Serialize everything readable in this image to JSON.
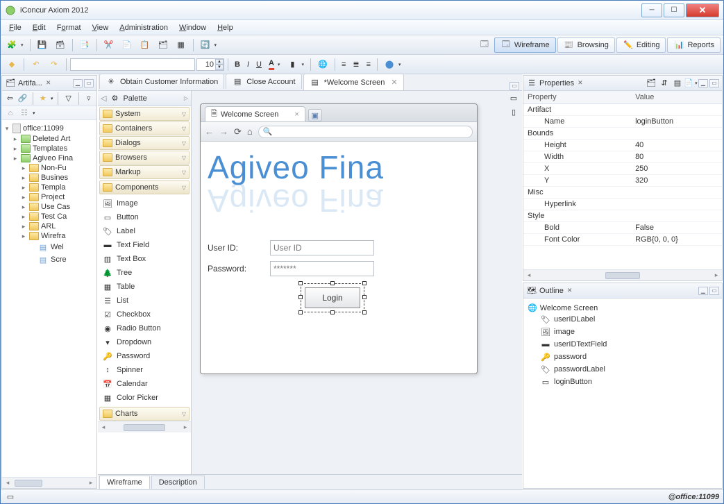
{
  "window": {
    "title": "iConcur Axiom 2012"
  },
  "menus": [
    "File",
    "Edit",
    "Format",
    "View",
    "Administration",
    "Window",
    "Help"
  ],
  "fontsize": "10",
  "modes": {
    "wireframe": "Wireframe",
    "browsing": "Browsing",
    "editing": "Editing",
    "reports": "Reports"
  },
  "leftPane": {
    "title": "Artifa...",
    "root": "office:11099",
    "nodes": [
      {
        "l": "Deleted Art",
        "c": "grn",
        "i": 1
      },
      {
        "l": "Templates",
        "c": "grn",
        "i": 1
      },
      {
        "l": "Agiveo Fina",
        "c": "grn",
        "i": 1
      },
      {
        "l": "Non-Fu",
        "c": "yel",
        "i": 2
      },
      {
        "l": "Busines",
        "c": "yel",
        "i": 2
      },
      {
        "l": "Templa",
        "c": "yel",
        "i": 2
      },
      {
        "l": "Project",
        "c": "yel",
        "i": 2
      },
      {
        "l": "Use Cas",
        "c": "yel",
        "i": 2
      },
      {
        "l": "Test Ca",
        "c": "yel",
        "i": 2
      },
      {
        "l": "ARL",
        "c": "yel",
        "i": 2
      },
      {
        "l": "Wirefra",
        "c": "yel",
        "i": 2
      },
      {
        "l": "Wel",
        "c": "doc",
        "i": 3
      },
      {
        "l": "Scre",
        "c": "doc",
        "i": 3
      }
    ]
  },
  "editorTabs": [
    {
      "label": "Obtain Customer Information",
      "ico": "flow"
    },
    {
      "label": "Close Account",
      "ico": "doc"
    },
    {
      "label": "*Welcome Screen",
      "ico": "doc",
      "active": true
    }
  ],
  "palette": {
    "title": "Palette",
    "cats": [
      "System",
      "Containers",
      "Dialogs",
      "Browsers",
      "Markup"
    ],
    "open": "Components",
    "items": [
      "Image",
      "Button",
      "Label",
      "Text Field",
      "Text Box",
      "Tree",
      "Table",
      "List",
      "Checkbox",
      "Radio Button",
      "Dropdown",
      "Password",
      "Spinner",
      "Calendar",
      "Color Picker"
    ],
    "last": "Charts"
  },
  "mockup": {
    "tab": "Welcome Screen",
    "logo": "Agiveo Fina",
    "userLabel": "User ID:",
    "userPlaceholder": "User ID",
    "passLabel": "Password:",
    "passValue": "*******",
    "login": "Login"
  },
  "bottomTabs": {
    "a": "Wireframe",
    "b": "Description"
  },
  "propsPane": {
    "title": "Properties",
    "cols": {
      "a": "Property",
      "b": "Value"
    },
    "rows": [
      {
        "g": "Artifact"
      },
      {
        "k": "Name",
        "v": "loginButton",
        "i": 1
      },
      {
        "g": "Bounds"
      },
      {
        "k": "Height",
        "v": "40",
        "i": 1
      },
      {
        "k": "Width",
        "v": "80",
        "i": 1
      },
      {
        "k": "X",
        "v": "250",
        "i": 1
      },
      {
        "k": "Y",
        "v": "320",
        "i": 1
      },
      {
        "g": "Misc"
      },
      {
        "k": "Hyperlink",
        "v": "",
        "i": 1
      },
      {
        "g": "Style"
      },
      {
        "k": "Bold",
        "v": "False",
        "i": 1
      },
      {
        "k": "Font Color",
        "v": "RGB{0, 0, 0}",
        "i": 1
      }
    ]
  },
  "outlinePane": {
    "title": "Outline",
    "root": "Welcome Screen",
    "items": [
      "userIDLabel",
      "image",
      "userIDTextField",
      "password",
      "passwordLabel",
      "loginButton"
    ]
  },
  "status": {
    "right": "@office:11099"
  }
}
